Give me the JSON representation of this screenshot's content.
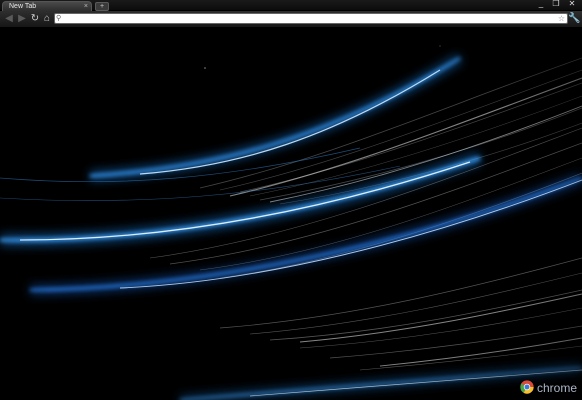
{
  "tab": {
    "title": "New Tab",
    "close_icon": "close-icon"
  },
  "newtab": {
    "icon": "plus-icon",
    "glyph": "+"
  },
  "window": {
    "minimize": "_",
    "maximize": "❐",
    "close": "✕"
  },
  "toolbar": {
    "back_icon": "back-arrow-icon",
    "forward_icon": "forward-arrow-icon",
    "reload_icon": "reload-icon",
    "home_icon": "home-icon",
    "wrench_icon": "wrench-icon"
  },
  "omnibox": {
    "value": "",
    "placeholder": "",
    "star_icon": "star-icon"
  },
  "theme": {
    "accent": "#1e90ff",
    "background": "#000000",
    "brand_text": "chrome"
  }
}
